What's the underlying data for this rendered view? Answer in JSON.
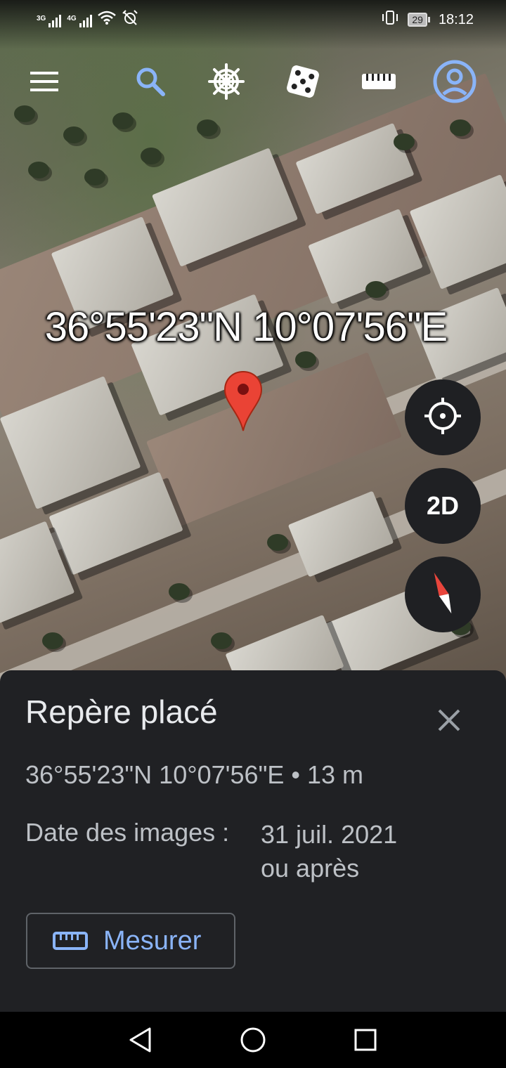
{
  "status_bar": {
    "network_1": "3G",
    "network_2": "4G",
    "battery": "29",
    "time": "18:12"
  },
  "toolbar": {
    "icons": [
      "menu-icon",
      "search-icon",
      "voyager-icon",
      "random-dice-icon",
      "ruler-icon",
      "account-icon"
    ],
    "accent": "#8ab4f8"
  },
  "map": {
    "coordinates": "36°55'23\"N 10°07'56\"E",
    "pin_color": "#ea4335"
  },
  "controls": {
    "mode_label": "2D"
  },
  "sheet": {
    "title": "Repère placé",
    "coords_line": "36°55'23\"N 10°07'56\"E • 13 m",
    "date_label": "Date des images :",
    "date_line1": "31 juil. 2021",
    "date_line2": "ou après",
    "measure_label": "Mesurer"
  },
  "colors": {
    "sheet_bg": "#202124",
    "link": "#8ab4f8",
    "compass_red": "#e8453c"
  }
}
